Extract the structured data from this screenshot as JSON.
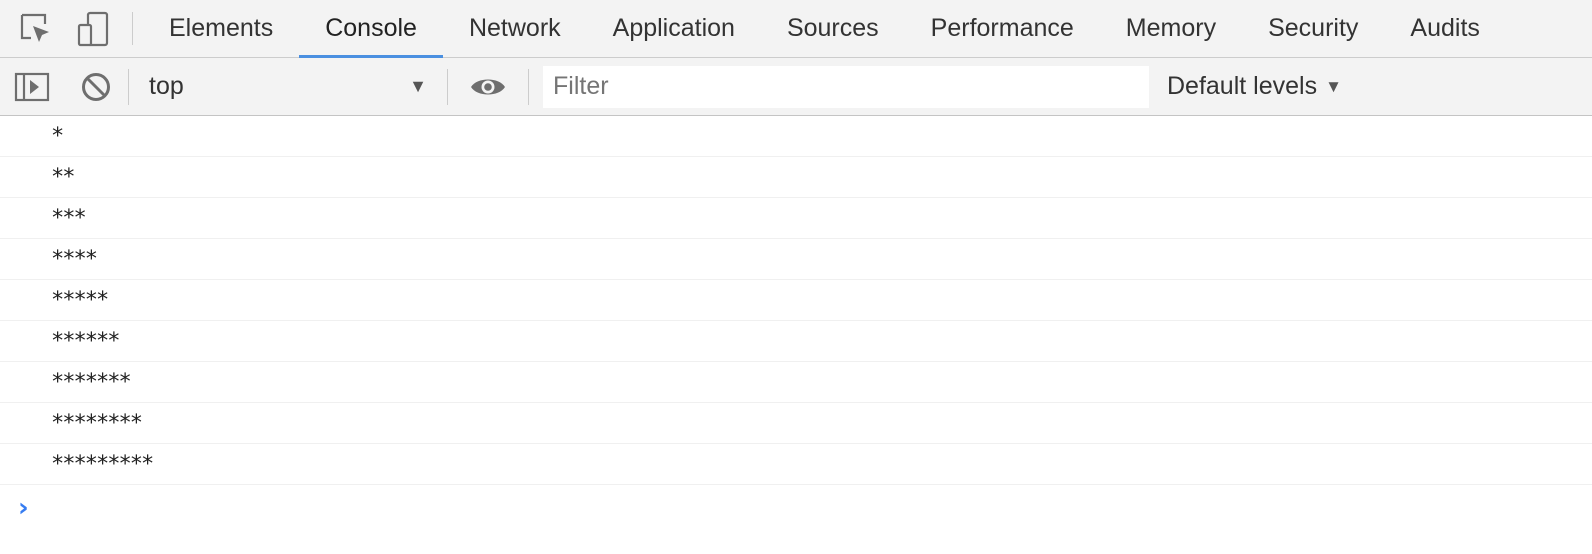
{
  "tabs": [
    {
      "label": "Elements",
      "active": false
    },
    {
      "label": "Console",
      "active": true
    },
    {
      "label": "Network",
      "active": false
    },
    {
      "label": "Application",
      "active": false
    },
    {
      "label": "Sources",
      "active": false
    },
    {
      "label": "Performance",
      "active": false
    },
    {
      "label": "Memory",
      "active": false
    },
    {
      "label": "Security",
      "active": false
    },
    {
      "label": "Audits",
      "active": false
    }
  ],
  "icons": {
    "inspect": "inspect-element-icon",
    "device": "device-toolbar-icon",
    "sidebar": "show-sidebar-icon",
    "clear": "clear-console-icon",
    "eye": "live-expression-eye-icon",
    "prompt": "console-prompt-chevron-icon"
  },
  "toolbar": {
    "context": "top",
    "filter_placeholder": "Filter",
    "filter_value": "",
    "levels_label": "Default levels"
  },
  "console": {
    "messages": [
      "*",
      "**",
      "***",
      "****",
      "*****",
      "******",
      "*******",
      "********",
      "*********"
    ],
    "prompt_symbol": "›"
  },
  "colors": {
    "accent": "#4a8fe0",
    "prompt": "#367cf1",
    "toolbar_bg": "#f3f3f3"
  }
}
